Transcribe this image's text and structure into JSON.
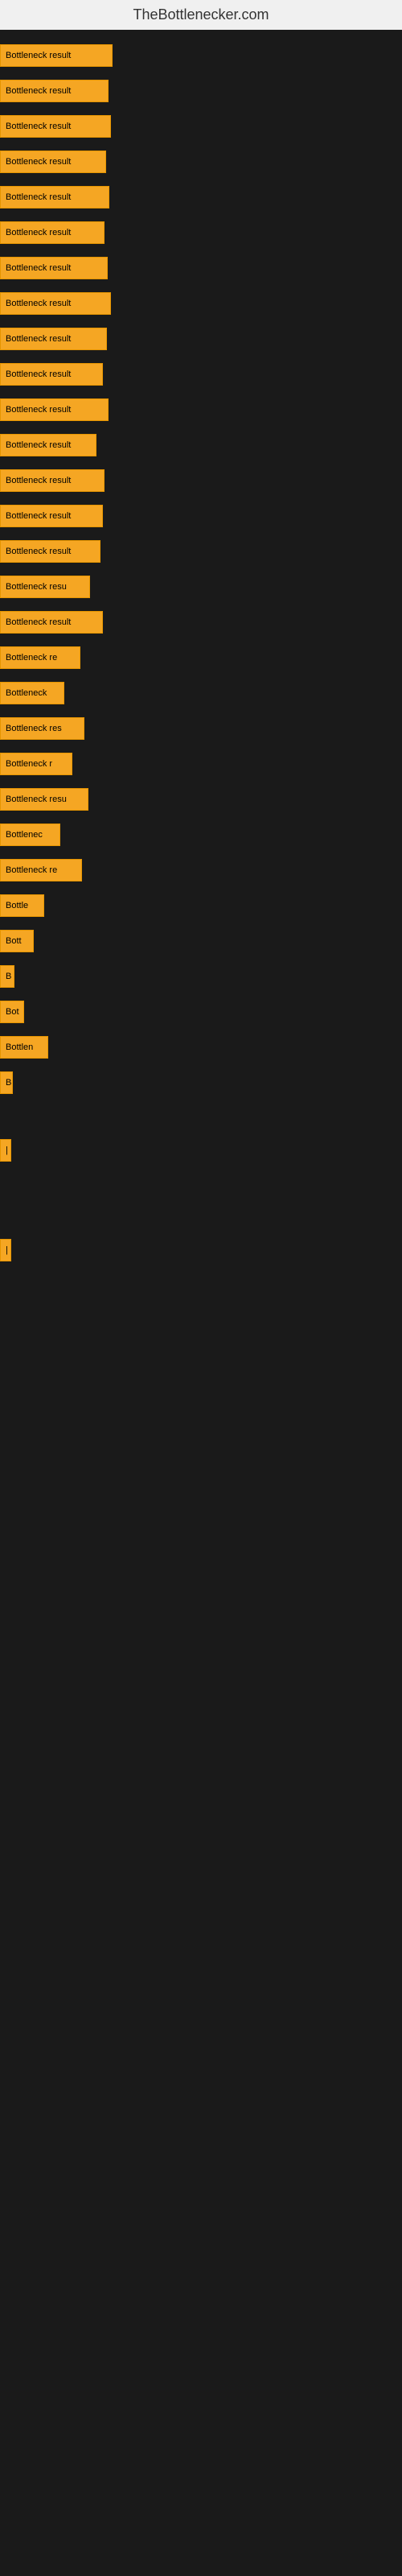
{
  "site": {
    "title": "TheBottlenecker.com"
  },
  "bars": [
    {
      "label": "Bottleneck result",
      "width": 140
    },
    {
      "label": "Bottleneck result",
      "width": 135
    },
    {
      "label": "Bottleneck result",
      "width": 138
    },
    {
      "label": "Bottleneck result",
      "width": 132
    },
    {
      "label": "Bottleneck result",
      "width": 136
    },
    {
      "label": "Bottleneck result",
      "width": 130
    },
    {
      "label": "Bottleneck result",
      "width": 134
    },
    {
      "label": "Bottleneck result",
      "width": 138
    },
    {
      "label": "Bottleneck result",
      "width": 133
    },
    {
      "label": "Bottleneck result",
      "width": 128
    },
    {
      "label": "Bottleneck result",
      "width": 135
    },
    {
      "label": "Bottleneck result",
      "width": 120
    },
    {
      "label": "Bottleneck result",
      "width": 130
    },
    {
      "label": "Bottleneck result",
      "width": 128
    },
    {
      "label": "Bottleneck result",
      "width": 125
    },
    {
      "label": "Bottleneck resu",
      "width": 112
    },
    {
      "label": "Bottleneck result",
      "width": 128
    },
    {
      "label": "Bottleneck re",
      "width": 100
    },
    {
      "label": "Bottleneck",
      "width": 80
    },
    {
      "label": "Bottleneck res",
      "width": 105
    },
    {
      "label": "Bottleneck r",
      "width": 90
    },
    {
      "label": "Bottleneck resu",
      "width": 110
    },
    {
      "label": "Bottlenec",
      "width": 75
    },
    {
      "label": "Bottleneck re",
      "width": 102
    },
    {
      "label": "Bottle",
      "width": 55
    },
    {
      "label": "Bott",
      "width": 42
    },
    {
      "label": "B",
      "width": 18
    },
    {
      "label": "Bot",
      "width": 30
    },
    {
      "label": "Bottlen",
      "width": 60
    },
    {
      "label": "B",
      "width": 16
    },
    {
      "label": "",
      "width": 0
    },
    {
      "label": "",
      "width": 0
    },
    {
      "label": "|",
      "width": 8
    },
    {
      "label": "",
      "width": 0
    },
    {
      "label": "",
      "width": 0
    },
    {
      "label": "",
      "width": 0
    },
    {
      "label": "",
      "width": 0
    },
    {
      "label": "|",
      "width": 8
    }
  ]
}
